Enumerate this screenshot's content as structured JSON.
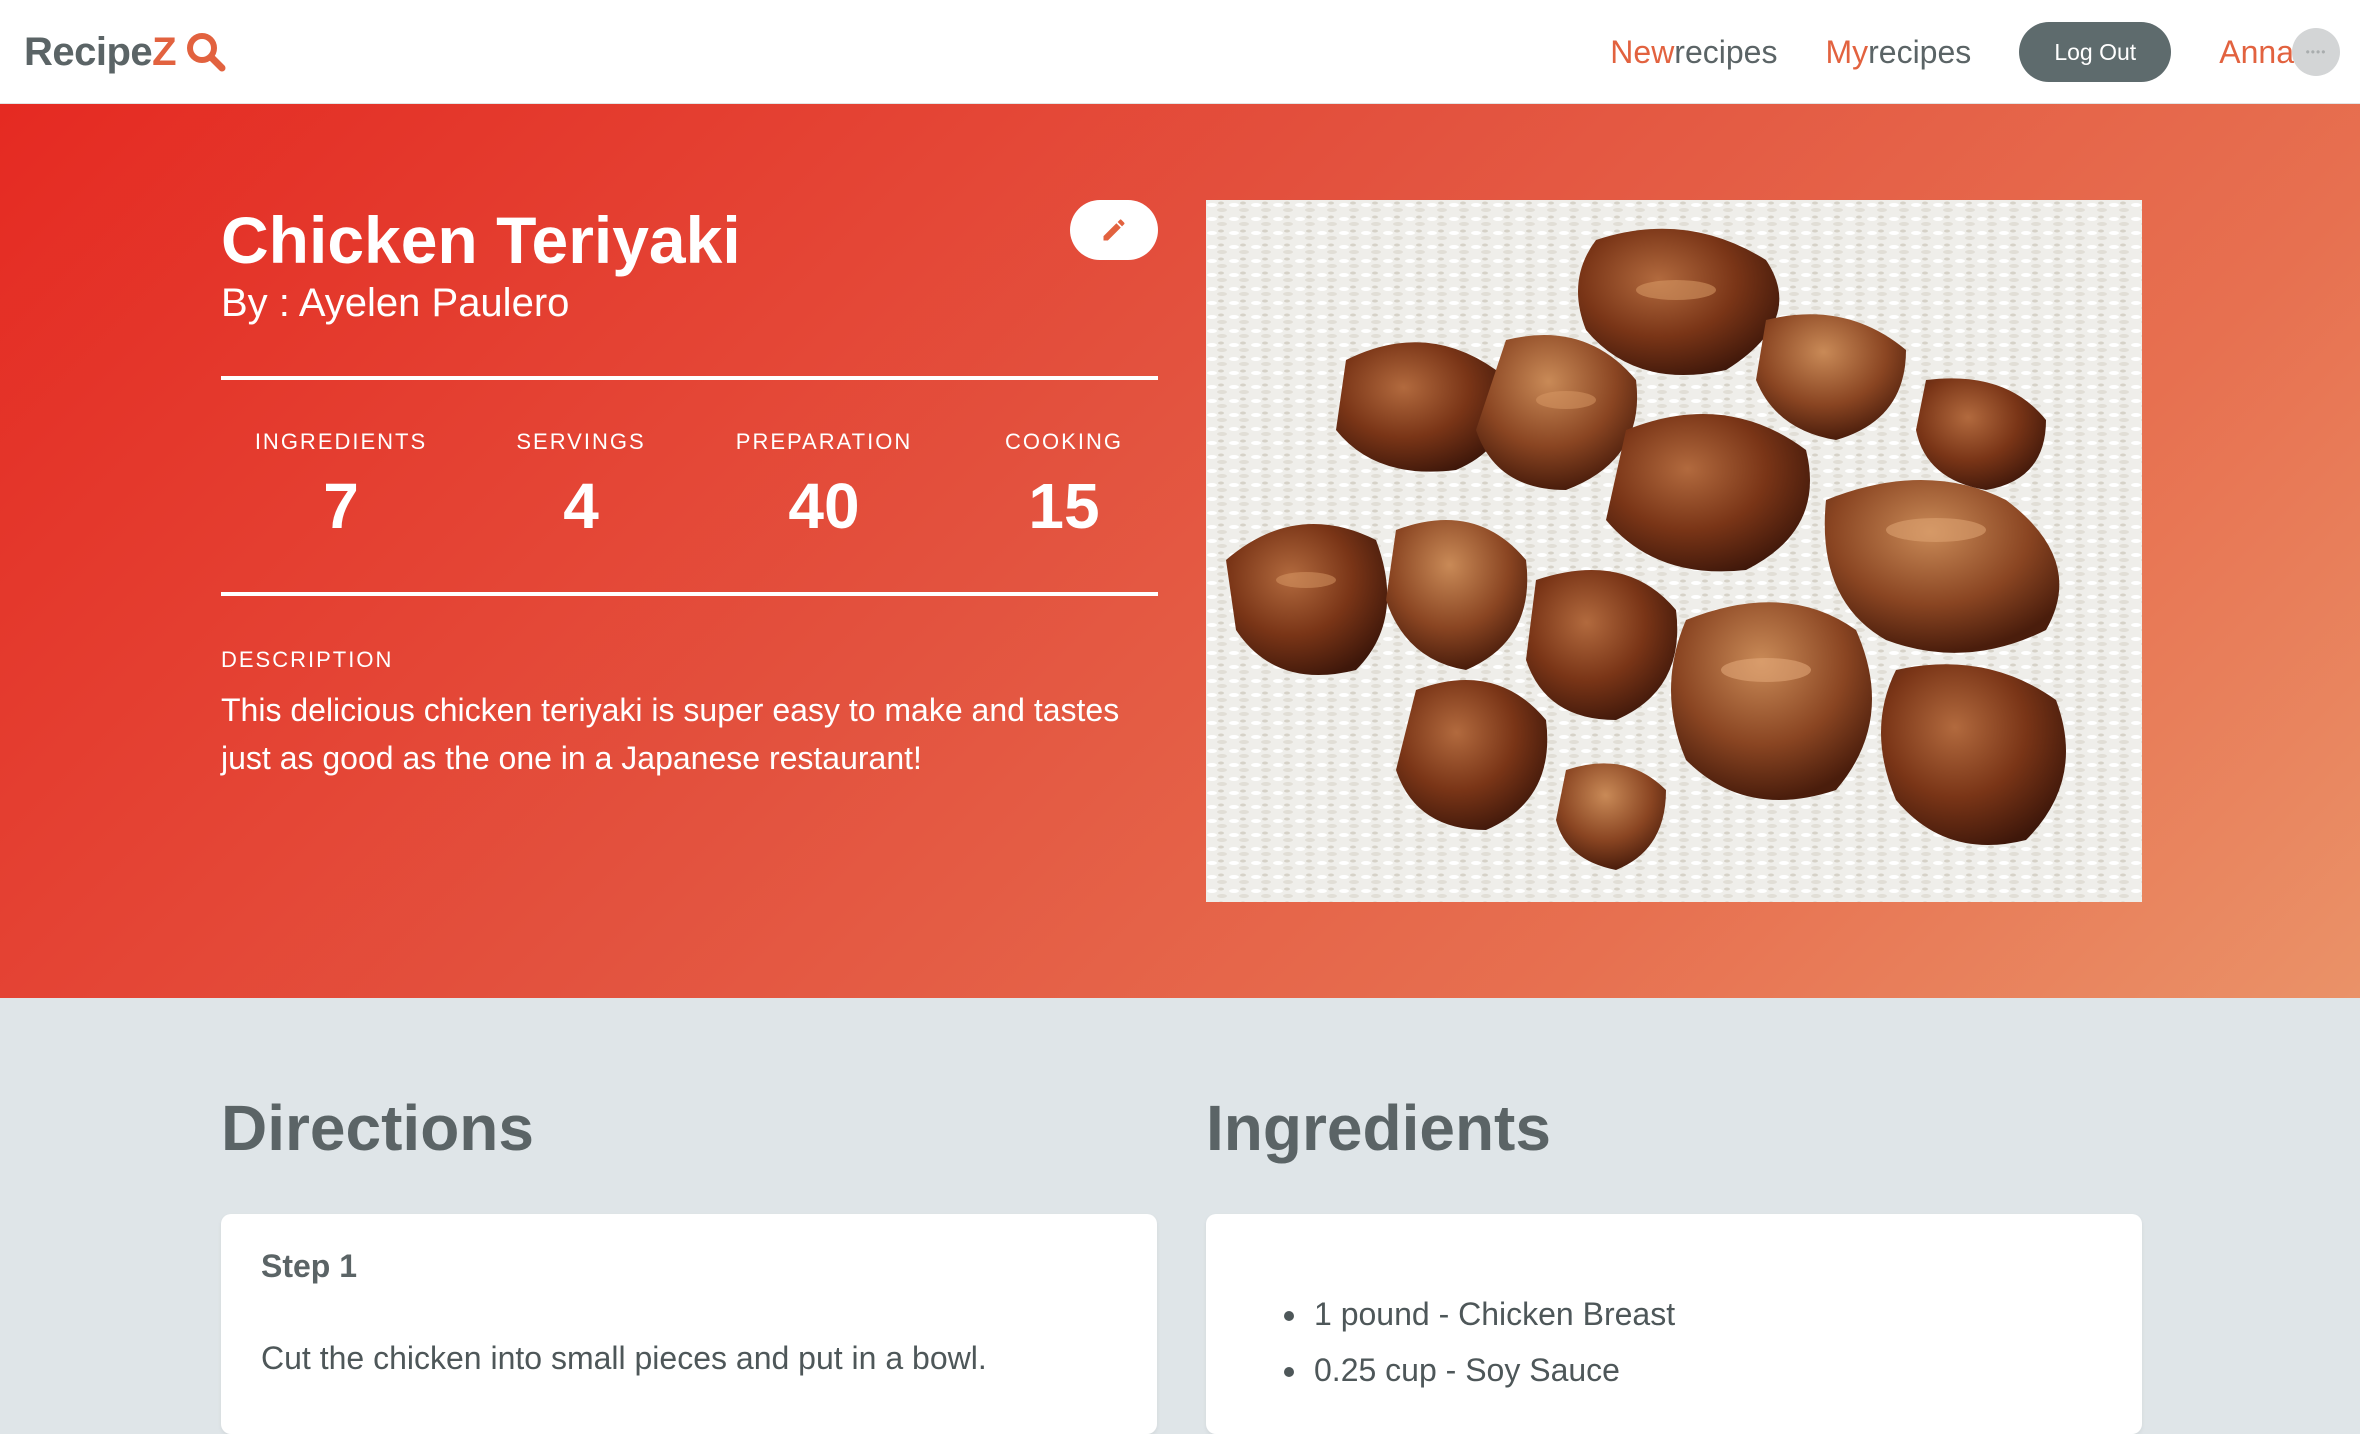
{
  "app": {
    "logo_part1": "Recipe",
    "logo_part2": "Z"
  },
  "nav": {
    "new_recipes": {
      "highlight": "New",
      "rest": "recipes"
    },
    "my_recipes": {
      "highlight": "My",
      "rest": "recipes"
    },
    "logout_label": "Log Out",
    "user_name": "Anna",
    "icons": {
      "logo_search": "magnifier-icon",
      "avatar": "user-avatar-icon"
    }
  },
  "recipe": {
    "title": "Chicken Teriyaki",
    "author": "By : Ayelen Paulero",
    "edit_icon": "pencil-icon",
    "stats": [
      {
        "label": "INGREDIENTS",
        "value": "7"
      },
      {
        "label": "SERVINGS",
        "value": "4"
      },
      {
        "label": "PREPARATION",
        "value": "40"
      },
      {
        "label": "COOKING",
        "value": "15"
      }
    ],
    "description_label": "DESCRIPTION",
    "description": "This delicious chicken teriyaki is super easy to make and tastes just as good as the one in a Japanese restaurant!"
  },
  "directions": {
    "title": "Directions",
    "steps": [
      {
        "title": "Step 1",
        "text": "Cut the chicken into small pieces and put in a bowl."
      }
    ]
  },
  "ingredients": {
    "title": "Ingredients",
    "items": [
      "1 pound - Chicken Breast",
      "0.25 cup - Soy Sauce"
    ]
  },
  "colors": {
    "accent": "#e2623f",
    "text_dark": "#5b6466",
    "logout_bg": "#5e6b6d",
    "page_bg": "#dfe5e8",
    "hero_gradient_start": "#e52a22",
    "hero_gradient_end": "#ea9268"
  }
}
